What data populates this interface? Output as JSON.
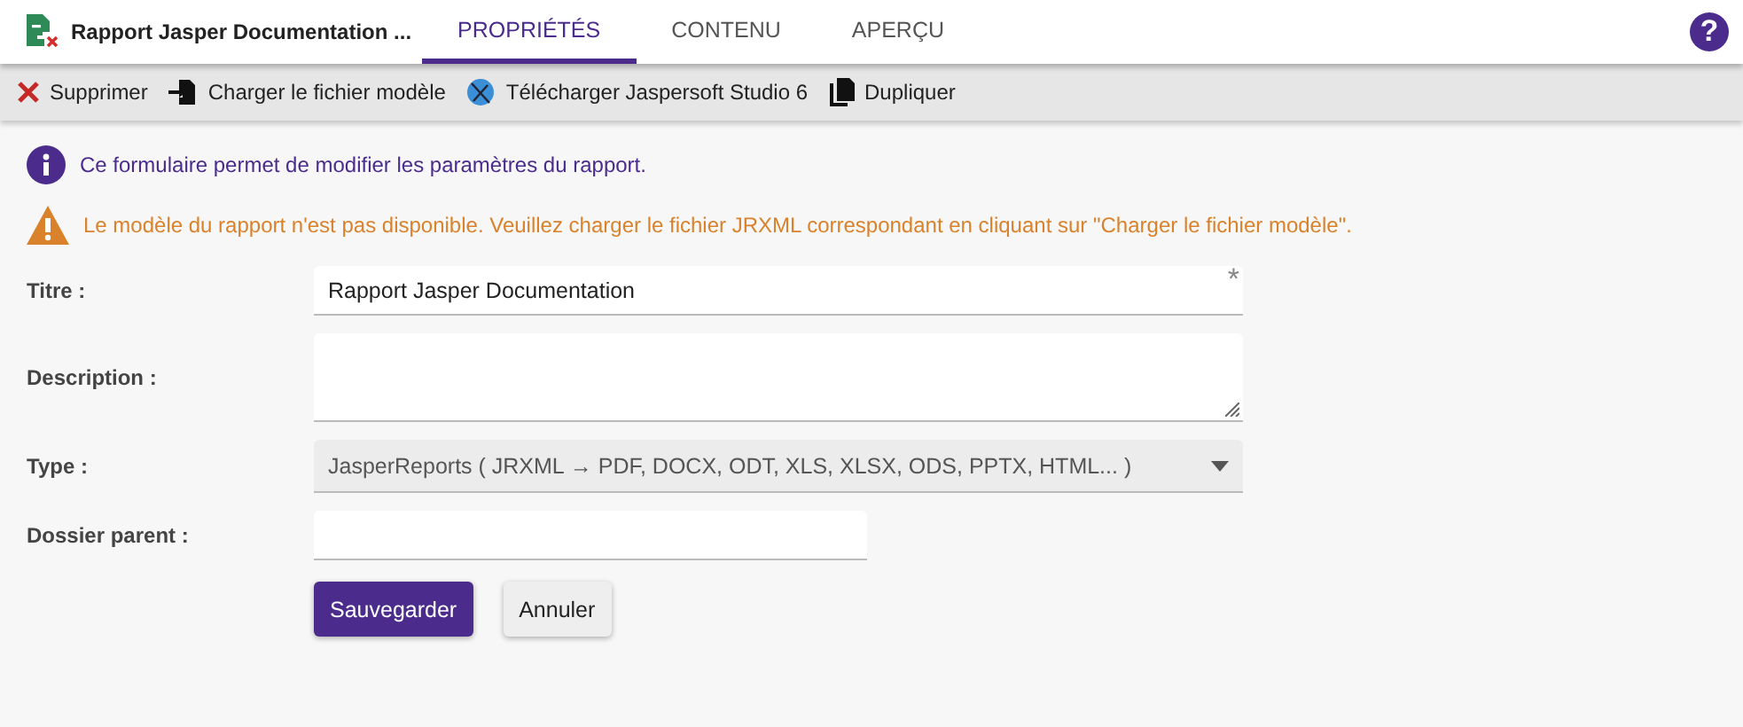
{
  "header": {
    "title": "Rapport Jasper Documentation ...",
    "help": "?"
  },
  "tabs": [
    {
      "label": "PROPRIÉTÉS",
      "selected": true
    },
    {
      "label": "CONTENU",
      "selected": false
    },
    {
      "label": "APERÇU",
      "selected": false
    }
  ],
  "toolbar": [
    {
      "kind": "delete",
      "label": "Supprimer"
    },
    {
      "kind": "upload",
      "label": "Charger le fichier modèle"
    },
    {
      "kind": "studio",
      "label": "Télécharger Jaspersoft Studio 6"
    },
    {
      "kind": "duplicate",
      "label": "Dupliquer"
    }
  ],
  "messages": [
    {
      "kind": "info",
      "text": "Ce formulaire permet de modifier les paramètres du rapport."
    },
    {
      "kind": "warning",
      "text": "Le modèle du rapport n'est pas disponible. Veuillez charger le fichier JRXML correspondant en cliquant sur \"Charger le fichier modèle\"."
    }
  ],
  "fields": [
    {
      "kind": "text",
      "label": "Titre :",
      "value": "Rapport Jasper Documentation",
      "required_mark": "*"
    },
    {
      "kind": "textarea",
      "label": "Description :"
    },
    {
      "kind": "select",
      "label": "Type :",
      "value": "JasperReports ( JRXML → PDF, DOCX, ODT, XLS, XLSX, ODS, PPTX, HTML... )",
      "disabled": true
    },
    {
      "kind": "short",
      "label": "Dossier parent :"
    }
  ],
  "buttons": [
    {
      "kind": "primary",
      "label": "Sauvegarder"
    },
    {
      "kind": "secondary",
      "label": "Annuler"
    }
  ]
}
